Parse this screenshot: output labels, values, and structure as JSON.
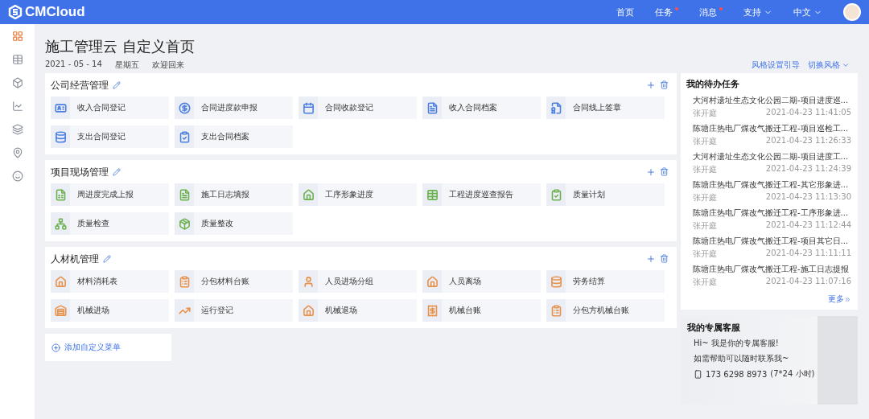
{
  "brand": {
    "name": "CMCloud"
  },
  "nav": [
    {
      "label": "首页",
      "dot": false,
      "dropdown": false
    },
    {
      "label": "任务",
      "dot": true,
      "dropdown": false
    },
    {
      "label": "消息",
      "dot": true,
      "dropdown": false
    },
    {
      "label": "支持",
      "dot": false,
      "dropdown": true
    },
    {
      "label": "中文",
      "dot": false,
      "dropdown": true
    }
  ],
  "sidebar": {
    "items": [
      {
        "selected": true
      },
      {
        "selected": false
      },
      {
        "selected": false
      },
      {
        "selected": false
      },
      {
        "selected": false
      },
      {
        "selected": false
      },
      {
        "selected": false
      }
    ]
  },
  "header": {
    "title": "施工管理云 自定义首页",
    "date": "2021 - 05 - 14",
    "weekday": "星期五",
    "greeting": "欢迎回来",
    "links": [
      {
        "label": "风格设置引导",
        "dropdown": false
      },
      {
        "label": "切换风格",
        "dropdown": true
      }
    ]
  },
  "sections": [
    {
      "title": "公司经营管理",
      "color": "#4a7fe0",
      "items": [
        "收入合同登记",
        "合同进度款申报",
        "合同收款登记",
        "收入合同档案",
        "合同线上签章",
        "支出合同登记",
        "支出合同档案"
      ]
    },
    {
      "title": "项目现场管理",
      "color": "#6ab04c",
      "items": [
        "周进度完成上报",
        "施工日志填报",
        "工序形象进度",
        "工程进度巡查报告",
        "质量计划",
        "质量检查",
        "质量整改"
      ]
    },
    {
      "title": "人材机管理",
      "color": "#e8914a",
      "items": [
        "材料消耗表",
        "分包材料台账",
        "人员进场分组",
        "人员离场",
        "劳务结算",
        "机械进场",
        "运行登记",
        "机械退场",
        "机械台账",
        "分包方机械台账"
      ]
    }
  ],
  "add_menu": {
    "label": "添加自定义菜单"
  },
  "tasks": {
    "title": "我的待办任务",
    "more": "更多",
    "items": [
      {
        "title": "大河村遗址生态文化公园二期-项目进度巡...",
        "user": "张开庭",
        "time": "2021-04-23 11:41:05"
      },
      {
        "title": "陈塘庄热电厂煤改气搬迁工程-项目巡检工...",
        "user": "张开庭",
        "time": "2021-04-23 11:26:33"
      },
      {
        "title": "大河村遗址生态文化公园二期-项目进度工...",
        "user": "张开庭",
        "time": "2021-04-23 11:24:39"
      },
      {
        "title": "陈塘庄热电厂煤改气搬迁工程-其它形象进...",
        "user": "张开庭",
        "time": "2021-04-23 11:13:30"
      },
      {
        "title": "陈塘庄热电厂煤改气搬迁工程-工序形象进...",
        "user": "张开庭",
        "time": "2021-04-23 11:12:44"
      },
      {
        "title": "陈塘庄热电厂煤改气搬迁工程-项目其它日...",
        "user": "张开庭",
        "time": "2021-04-23 11:11:11"
      },
      {
        "title": "陈塘庄热电厂煤改气搬迁工程-施工日志提报",
        "user": "张开庭",
        "time": "2021-04-23 11:07:16"
      }
    ]
  },
  "service": {
    "title": "我的专属客服",
    "lines": [
      "Hi~ 我是你的专属客服!",
      "如需帮助可以随时联系我~"
    ],
    "phone": "173 6298 8973",
    "hours": "(7*24 小时)"
  }
}
